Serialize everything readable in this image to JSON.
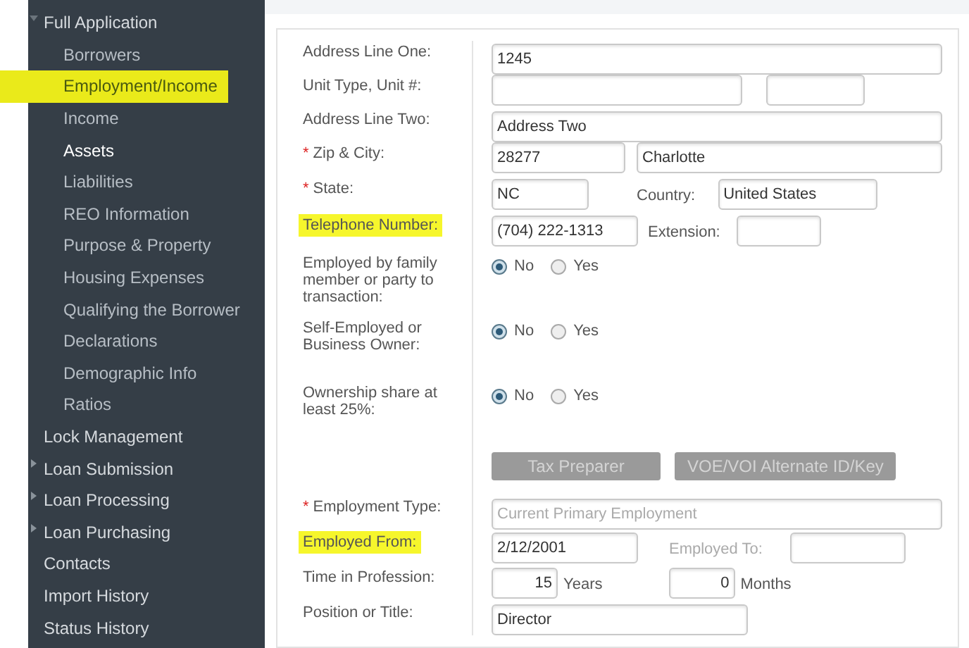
{
  "sidebar": {
    "items": [
      {
        "label": "Full Application",
        "kind": "expandable",
        "expanded": true,
        "children": [
          {
            "label": "Borrowers",
            "selected": false,
            "highlighted": false
          },
          {
            "label": "Employment/Income",
            "selected": false,
            "highlighted": true
          },
          {
            "label": "Income",
            "selected": false,
            "highlighted": false
          },
          {
            "label": "Assets",
            "selected": true,
            "highlighted": false
          },
          {
            "label": "Liabilities",
            "selected": false,
            "highlighted": false
          },
          {
            "label": "REO Information",
            "selected": false,
            "highlighted": false
          },
          {
            "label": "Purpose & Property",
            "selected": false,
            "highlighted": false
          },
          {
            "label": "Housing Expenses",
            "selected": false,
            "highlighted": false
          },
          {
            "label": "Qualifying the Borrower",
            "selected": false,
            "highlighted": false
          },
          {
            "label": "Declarations",
            "selected": false,
            "highlighted": false
          },
          {
            "label": "Demographic Info",
            "selected": false,
            "highlighted": false
          },
          {
            "label": "Ratios",
            "selected": false,
            "highlighted": false
          }
        ]
      },
      {
        "label": "Lock Management",
        "kind": "link"
      },
      {
        "label": "Loan Submission",
        "kind": "expandable",
        "expanded": false
      },
      {
        "label": "Loan Processing",
        "kind": "expandable",
        "expanded": false
      },
      {
        "label": "Loan Purchasing",
        "kind": "expandable",
        "expanded": false
      },
      {
        "label": "Contacts",
        "kind": "link"
      },
      {
        "label": "Import History",
        "kind": "link"
      },
      {
        "label": "Status History",
        "kind": "link"
      }
    ]
  },
  "form": {
    "rows": [
      {
        "kind": "single",
        "label": "Address Line One:",
        "highlighted": false,
        "value": "1245"
      },
      {
        "kind": "unit",
        "label": "Unit Type, Unit #:",
        "highlighted": false
      },
      {
        "kind": "single",
        "label": "Address Line Two:",
        "highlighted": false,
        "value": "Address Two"
      },
      {
        "kind": "zip_city",
        "label": "Zip & City:",
        "marker": "*",
        "highlighted": false,
        "zip": "28277",
        "city": "Charlotte"
      },
      {
        "kind": "state_country",
        "label": "State:",
        "marker": "*",
        "highlighted": false,
        "state": "NC",
        "country_label": "Country:",
        "country": "United States"
      },
      {
        "kind": "phone",
        "label": "Telephone Number:",
        "highlighted": true,
        "value": "(704) 222-1313",
        "extension_label": "Extension:"
      },
      {
        "kind": "radio",
        "label": "Employed by family member or party to transaction:",
        "highlighted": false,
        "options": [
          {
            "label": "No",
            "selected": true
          },
          {
            "label": "Yes",
            "selected": false
          }
        ]
      },
      {
        "kind": "radio",
        "label": "Self-Employed or Business Owner:",
        "highlighted": false,
        "options": [
          {
            "label": "No",
            "selected": true
          },
          {
            "label": "Yes",
            "selected": false
          }
        ]
      },
      {
        "kind": "radio",
        "label": "Ownership share at least 25%:",
        "highlighted": false,
        "options": [
          {
            "label": "No",
            "selected": true
          },
          {
            "label": "Yes",
            "selected": false
          }
        ]
      },
      {
        "kind": "buttons",
        "buttons": [
          {
            "label": "Tax Preparer",
            "disabled": true
          },
          {
            "label": "VOE/VOI Alternate ID/Key",
            "disabled": true
          }
        ]
      },
      {
        "kind": "select",
        "label": "Employment Type:",
        "marker": "*",
        "highlighted": false,
        "value": "Current Primary Employment",
        "disabled": true
      },
      {
        "kind": "dates",
        "label": "Employed From:",
        "highlighted": true,
        "value": "2/12/2001",
        "to_label": "Employed To:"
      },
      {
        "kind": "time",
        "label": "Time in Profession:",
        "highlighted": false,
        "years": "15",
        "years_unit": "Years",
        "months": "0",
        "months_unit": "Months"
      },
      {
        "kind": "short",
        "label": "Position or Title:",
        "highlighted": false,
        "value": "Director"
      }
    ]
  }
}
